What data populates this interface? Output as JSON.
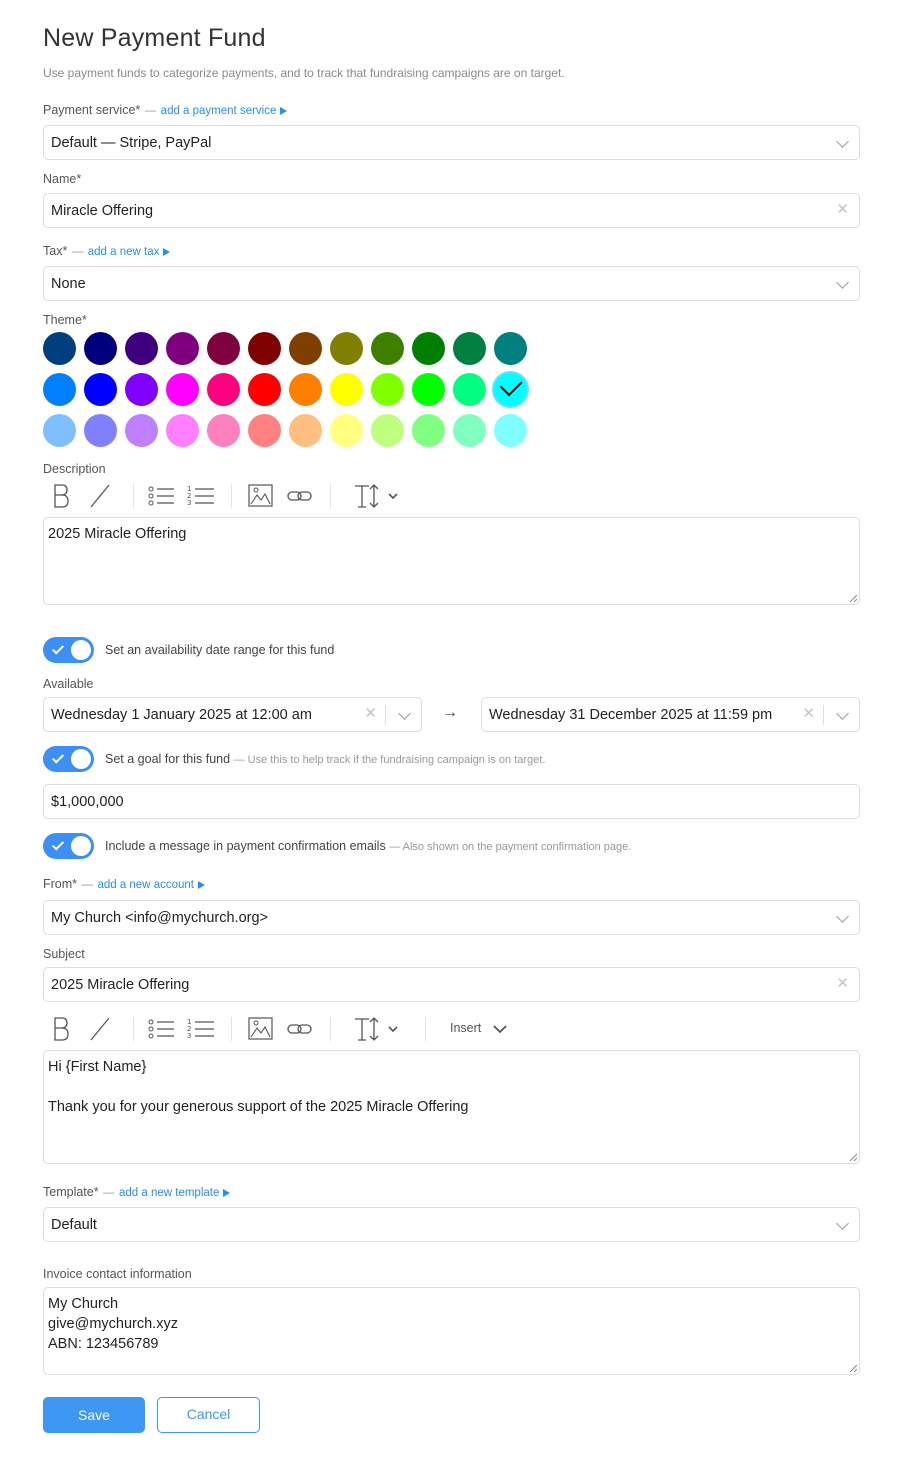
{
  "page": {
    "title": "New Payment Fund",
    "subtitle": "Use payment funds to categorize payments, and to track that fundraising campaigns are on target."
  },
  "payment_service": {
    "label": "Payment service*",
    "dash": "—",
    "link": "add a payment service",
    "value": "Default — Stripe, PayPal"
  },
  "name": {
    "label": "Name*",
    "value": "Miracle Offering"
  },
  "tax": {
    "label": "Tax*",
    "dash": "—",
    "link": "add a new tax",
    "value": "None"
  },
  "theme": {
    "label": "Theme*",
    "selected": "#00ffff",
    "colors": [
      [
        "#003f7f",
        "#00007f",
        "#3f007f",
        "#7f007f",
        "#7f003f",
        "#7f0000",
        "#7f3f00",
        "#7f7f00",
        "#3f7f00",
        "#007f00",
        "#007f3f",
        "#007f7f"
      ],
      [
        "#0080ff",
        "#0000ff",
        "#8000ff",
        "#ff00ff",
        "#ff0080",
        "#ff0000",
        "#ff8000",
        "#ffff00",
        "#80ff00",
        "#00ff00",
        "#00ff80",
        "#00ffff"
      ],
      [
        "#80bfff",
        "#8080ff",
        "#bf80ff",
        "#ff80ff",
        "#ff80bf",
        "#ff8080",
        "#ffbf80",
        "#ffff80",
        "#bfff80",
        "#80ff80",
        "#80ffbf",
        "#80ffff"
      ]
    ]
  },
  "description": {
    "label": "Description",
    "value": "2025 Miracle Offering"
  },
  "availability": {
    "toggle_label": "Set an availability date range for this fund",
    "toggle_on": true,
    "available_label": "Available",
    "start": "Wednesday 1 January 2025 at 12:00 am",
    "arrow": "→",
    "end": "Wednesday 31 December 2025 at 11:59 pm"
  },
  "goal": {
    "toggle_label": "Set a goal for this fund",
    "hint": "— Use this to help track if the fundraising campaign is on target.",
    "toggle_on": true,
    "value": "$1,000,000"
  },
  "message": {
    "toggle_label": "Include a message in payment confirmation emails",
    "hint": "— Also shown on the payment confirmation page.",
    "toggle_on": true,
    "from_label": "From*",
    "dash": "—",
    "from_link": "add a new account",
    "from_value": "My Church <info@mychurch.org>",
    "subject_label": "Subject",
    "subject_value": "2025 Miracle Offering",
    "insert_label": "Insert",
    "body": "Hi {First Name}\n\nThank you for your generous support of the 2025 Miracle Offering"
  },
  "template": {
    "label": "Template*",
    "dash": "—",
    "link": "add a new template",
    "value": "Default"
  },
  "invoice": {
    "label": "Invoice contact information",
    "value": "My Church\ngive@mychurch.xyz\nABN: 123456789"
  },
  "actions": {
    "save": "Save",
    "cancel": "Cancel"
  }
}
